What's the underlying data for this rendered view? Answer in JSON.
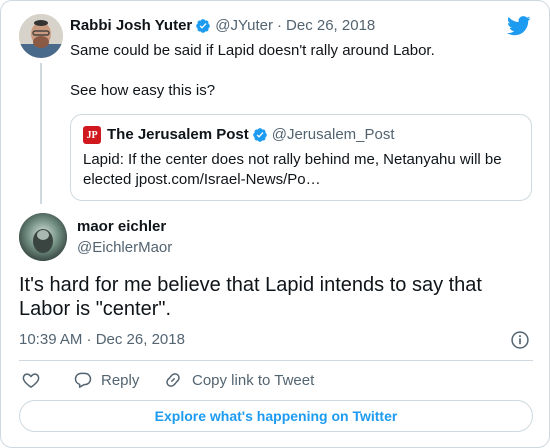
{
  "parent_tweet": {
    "name": "Rabbi Josh Yuter",
    "handle": "@JYuter",
    "separator": "·",
    "date": "Dec 26, 2018",
    "text": "Same could be said if Lapid doesn't rally around Labor.\n\nSee how easy this is?"
  },
  "quoted_tweet": {
    "logo_text": "JP",
    "name": "The Jerusalem Post",
    "handle": "@Jerusalem_Post",
    "text": "Lapid: If the center does not rally behind me, Netanyahu will be elected jpost.com/Israel-News/Po…"
  },
  "main_tweet": {
    "name": "maor eichler",
    "handle": "@EichlerMaor",
    "text": "It's hard for me believe that Lapid intends to say that Labor is \"center\".",
    "timestamp": "10:39 AM · Dec 26, 2018"
  },
  "actions": {
    "reply_label": "Reply",
    "copy_label": "Copy link to Tweet"
  },
  "explore_label": "Explore what's happening on Twitter",
  "icons": [
    "twitter-bird-icon",
    "verified-badge-icon",
    "info-icon",
    "heart-icon",
    "reply-icon",
    "link-icon"
  ],
  "colors": {
    "accent": "#1d9bf0",
    "muted_text": "#536471",
    "border": "#cfd9de",
    "jpost_red": "#d0191e"
  }
}
